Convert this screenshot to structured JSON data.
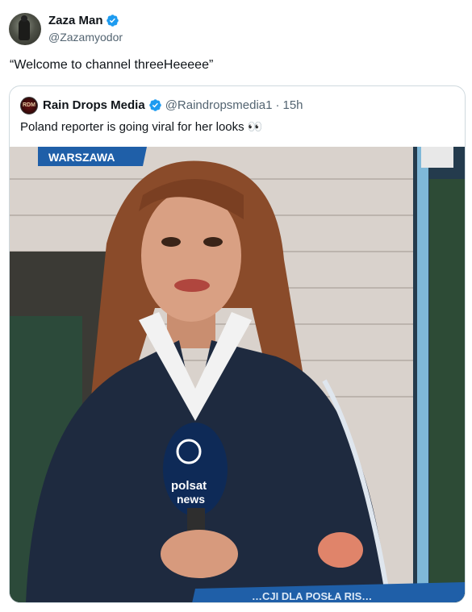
{
  "tweet": {
    "display_name": "Zaza Man",
    "handle": "@Zazamyodor",
    "text": "“Welcome to channel threeHeeeee”"
  },
  "quoted": {
    "display_name": "Rain Drops Media",
    "handle": "@Raindropsmedia1",
    "separator": "·",
    "time": "15h",
    "text": "Poland  reporter is going viral for her looks 👀",
    "avatar_text": "RDM"
  },
  "media": {
    "location_banner": "WARSZAWA",
    "mic_brand_line1": "polsat",
    "mic_brand_line2": "news",
    "bottom_ticker": "…CJI DLA POSŁA RIS…"
  },
  "colors": {
    "verified": "#1d9bf0",
    "banner": "#1f5fa8",
    "jacket": "#1e2a3f"
  }
}
